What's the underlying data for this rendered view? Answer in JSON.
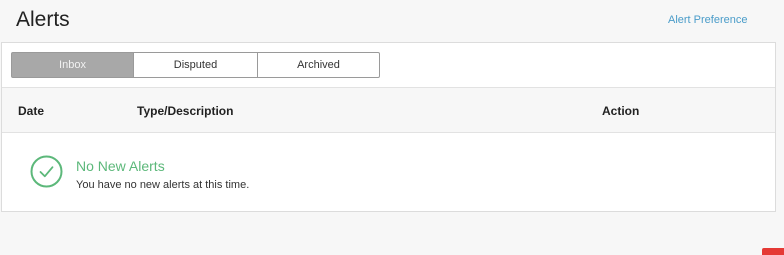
{
  "header": {
    "title": "Alerts",
    "preference_link": "Alert Preference"
  },
  "tabs": [
    {
      "label": "Inbox",
      "active": true
    },
    {
      "label": "Disputed",
      "active": false
    },
    {
      "label": "Archived",
      "active": false
    }
  ],
  "table": {
    "columns": [
      "Date",
      "Type/Description",
      "Action"
    ]
  },
  "empty_state": {
    "icon": "check-circle-icon",
    "title": "No New Alerts",
    "message": "You have no new alerts at this time."
  },
  "colors": {
    "link": "#4a9cc9",
    "success": "#5cb87a",
    "active_tab": "#a8a8a8",
    "badge": "#e53935"
  }
}
